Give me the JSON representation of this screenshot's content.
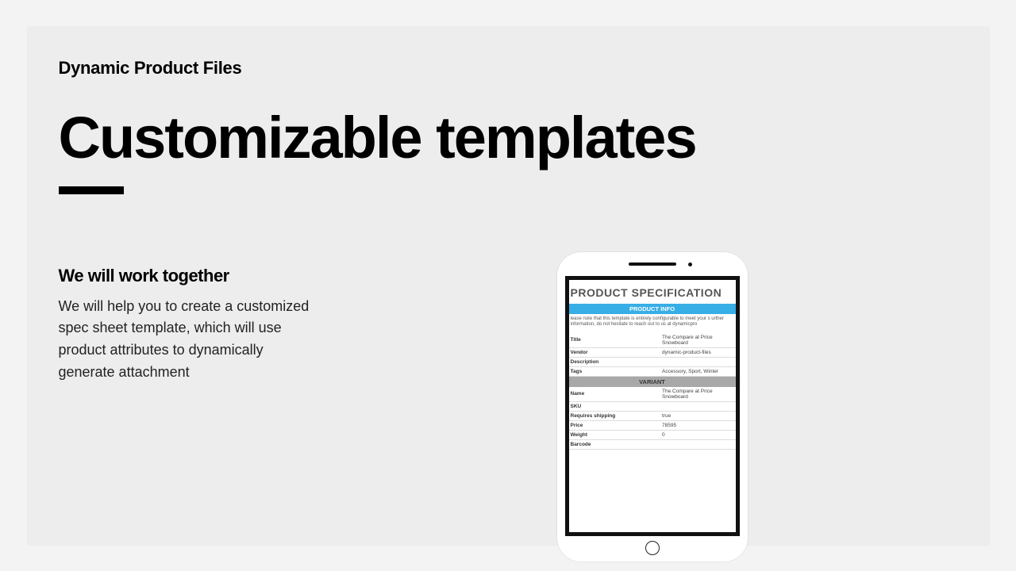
{
  "brand": "Dynamic Product Files",
  "headline": "Customizable templates",
  "subhead": "We will work together",
  "body": "We will help you to create a customized spec sheet template, which will use product attributes to dynamically generate attachment",
  "phone": {
    "doc_title": "PRODUCT SPECIFICATION",
    "section_product_info": "PRODUCT INFO",
    "note": "lease note that this template is entirely configurable to meet your s urther information, do not hesitate to reach out to us at dynamicpro",
    "product_rows": [
      {
        "label": "Title",
        "value": "The Compare at Price Snowboard"
      },
      {
        "label": "Vendor",
        "value": "dynamic-product-files"
      },
      {
        "label": "Description",
        "value": ""
      },
      {
        "label": "Tags",
        "value": "Accessory, Sport, Winter"
      }
    ],
    "section_variant": "VARIANT",
    "variant_rows": [
      {
        "label": "Name",
        "value": "The Compare at Price Snowboard"
      },
      {
        "label": "SKU",
        "value": ""
      },
      {
        "label": "Requires shipping",
        "value": "true"
      },
      {
        "label": "Price",
        "value": "78595"
      },
      {
        "label": "Weight",
        "value": "0"
      },
      {
        "label": "Barcode",
        "value": ""
      }
    ]
  }
}
